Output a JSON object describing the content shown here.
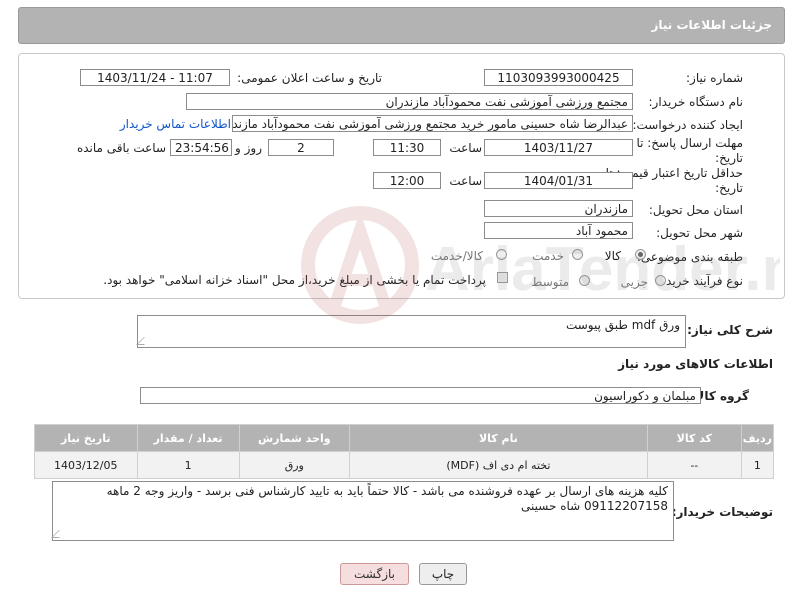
{
  "header": {
    "title": "جزئیات اطلاعات نیاز"
  },
  "form": {
    "need_number_label": "شماره نیاز:",
    "need_number": "1103093993000425",
    "announce_label": "تاریخ و ساعت اعلان عمومی:",
    "announce_value": "1403/11/24 - 11:07",
    "buyer_org_label": "نام دستگاه خریدار:",
    "buyer_org": "مجتمع ورزشی آموزشی نفت محمودآباد مازندران",
    "requester_label": "ایجاد کننده درخواست:",
    "requester": "عبدالرضا شاه حسینی مامور خرید مجتمع ورزشی آموزشی نفت محمودآباد مازند",
    "buyer_contact_link": "اطلاعات تماس خریدار",
    "reply_deadline_label": "مهلت ارسال پاسخ: تا تاریخ:",
    "reply_date": "1403/11/27",
    "time_label": "ساعت",
    "reply_time": "11:30",
    "days_value": "2",
    "days_label": "روز و",
    "remaining_time": "23:54:56",
    "remaining_label": "ساعت باقی مانده",
    "price_validity_label": "حداقل تاریخ اعتبار قیمت: تا تاریخ:",
    "validity_date": "1404/01/31",
    "validity_time": "12:00",
    "province_label": "استان محل تحویل:",
    "province": "مازندران",
    "city_label": "شهر محل تحویل:",
    "city": "محمود آباد",
    "category_label": "طبقه بندی موضوعی:",
    "category_options": [
      "کالا",
      "خدمت",
      "کالا/خدمت"
    ],
    "process_label": "نوع فرآیند خرید :",
    "process_options": [
      "جزیی",
      "متوسط"
    ],
    "payment_note": "پرداخت تمام یا بخشی از مبلغ خرید،از محل \"اسناد خزانه اسلامی\" خواهد بود."
  },
  "description": {
    "label": "شرح کلی نیاز:",
    "value": "ورق mdf طبق پیوست"
  },
  "goods": {
    "section_title": "اطلاعات کالاهای مورد نیاز",
    "group_label": "گروه کالا:",
    "group_value": "مبلمان و دکوراسیون",
    "columns": [
      "ردیف",
      "کد کالا",
      "نام کالا",
      "واحد شمارش",
      "تعداد / مقدار",
      "تاریخ نیاز"
    ],
    "rows": [
      {
        "row": "1",
        "code": "--",
        "name": "تخته ام دی اف (MDF)",
        "unit": "ورق",
        "qty": "1",
        "date": "1403/12/05"
      }
    ]
  },
  "buyer_notes": {
    "label": "توضیحات خریدار:",
    "value": "کلیه هزینه های ارسال بر عهده فروشنده می باشد - کالا حتماً باید به تایید کارشناس فنی برسد - واریز وجه 2 ماهه 09112207158 شاه حسینی"
  },
  "buttons": {
    "print": "چاپ",
    "back": "بازگشت"
  },
  "watermark": {
    "text": "AriaTender.neT"
  }
}
